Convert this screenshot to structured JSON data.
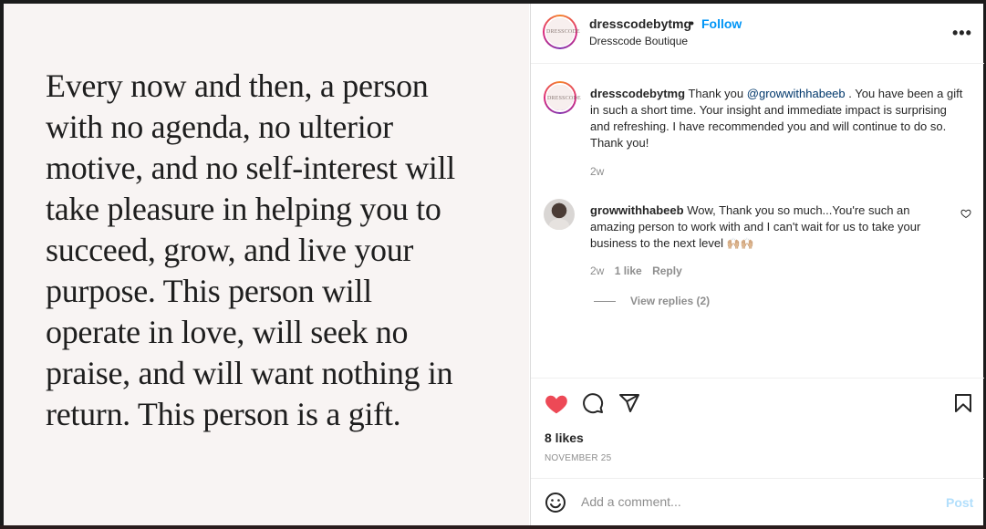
{
  "post": {
    "quote_lines": [
      "Every now and then, a person",
      "with no agenda, no ulterior",
      "motive, and no self-interest will",
      "take pleasure in helping you to",
      "succeed, grow, and live your",
      "purpose. This person will",
      "operate in love, will seek no",
      "praise, and will want nothing in",
      "return. This person is a gift."
    ]
  },
  "header": {
    "username": "dresscodebytmg",
    "dot": "•",
    "follow_label": "Follow",
    "subtitle": "Dresscode Boutique",
    "more_label": "•••",
    "avatar_text": "DRESSCODE"
  },
  "comments": [
    {
      "username": "dresscodebytmg",
      "text_before": "Thank you ",
      "mention": "@growwithhabeeb",
      "text_after": " . You have been a gift in such a short time. Your insight and immediate impact is surprising and refreshing. I have recommended you and will continue to do so. Thank you!",
      "time": "2w"
    },
    {
      "username": "growwithhabeeb",
      "text": "Wow, Thank you so much...You're such an amazing person to work with and I can't wait for us to take your business to the next level ",
      "emoji": "🙌🏼🙌🏼",
      "time": "2w",
      "likes": "1 like",
      "reply_label": "Reply",
      "view_replies": "View replies (2)"
    }
  ],
  "actions": {
    "likes": "8 likes",
    "date": "NOVEMBER 25",
    "liked": true,
    "like_color": "#ed4956"
  },
  "composer": {
    "placeholder": "Add a comment...",
    "post_label": "Post"
  }
}
